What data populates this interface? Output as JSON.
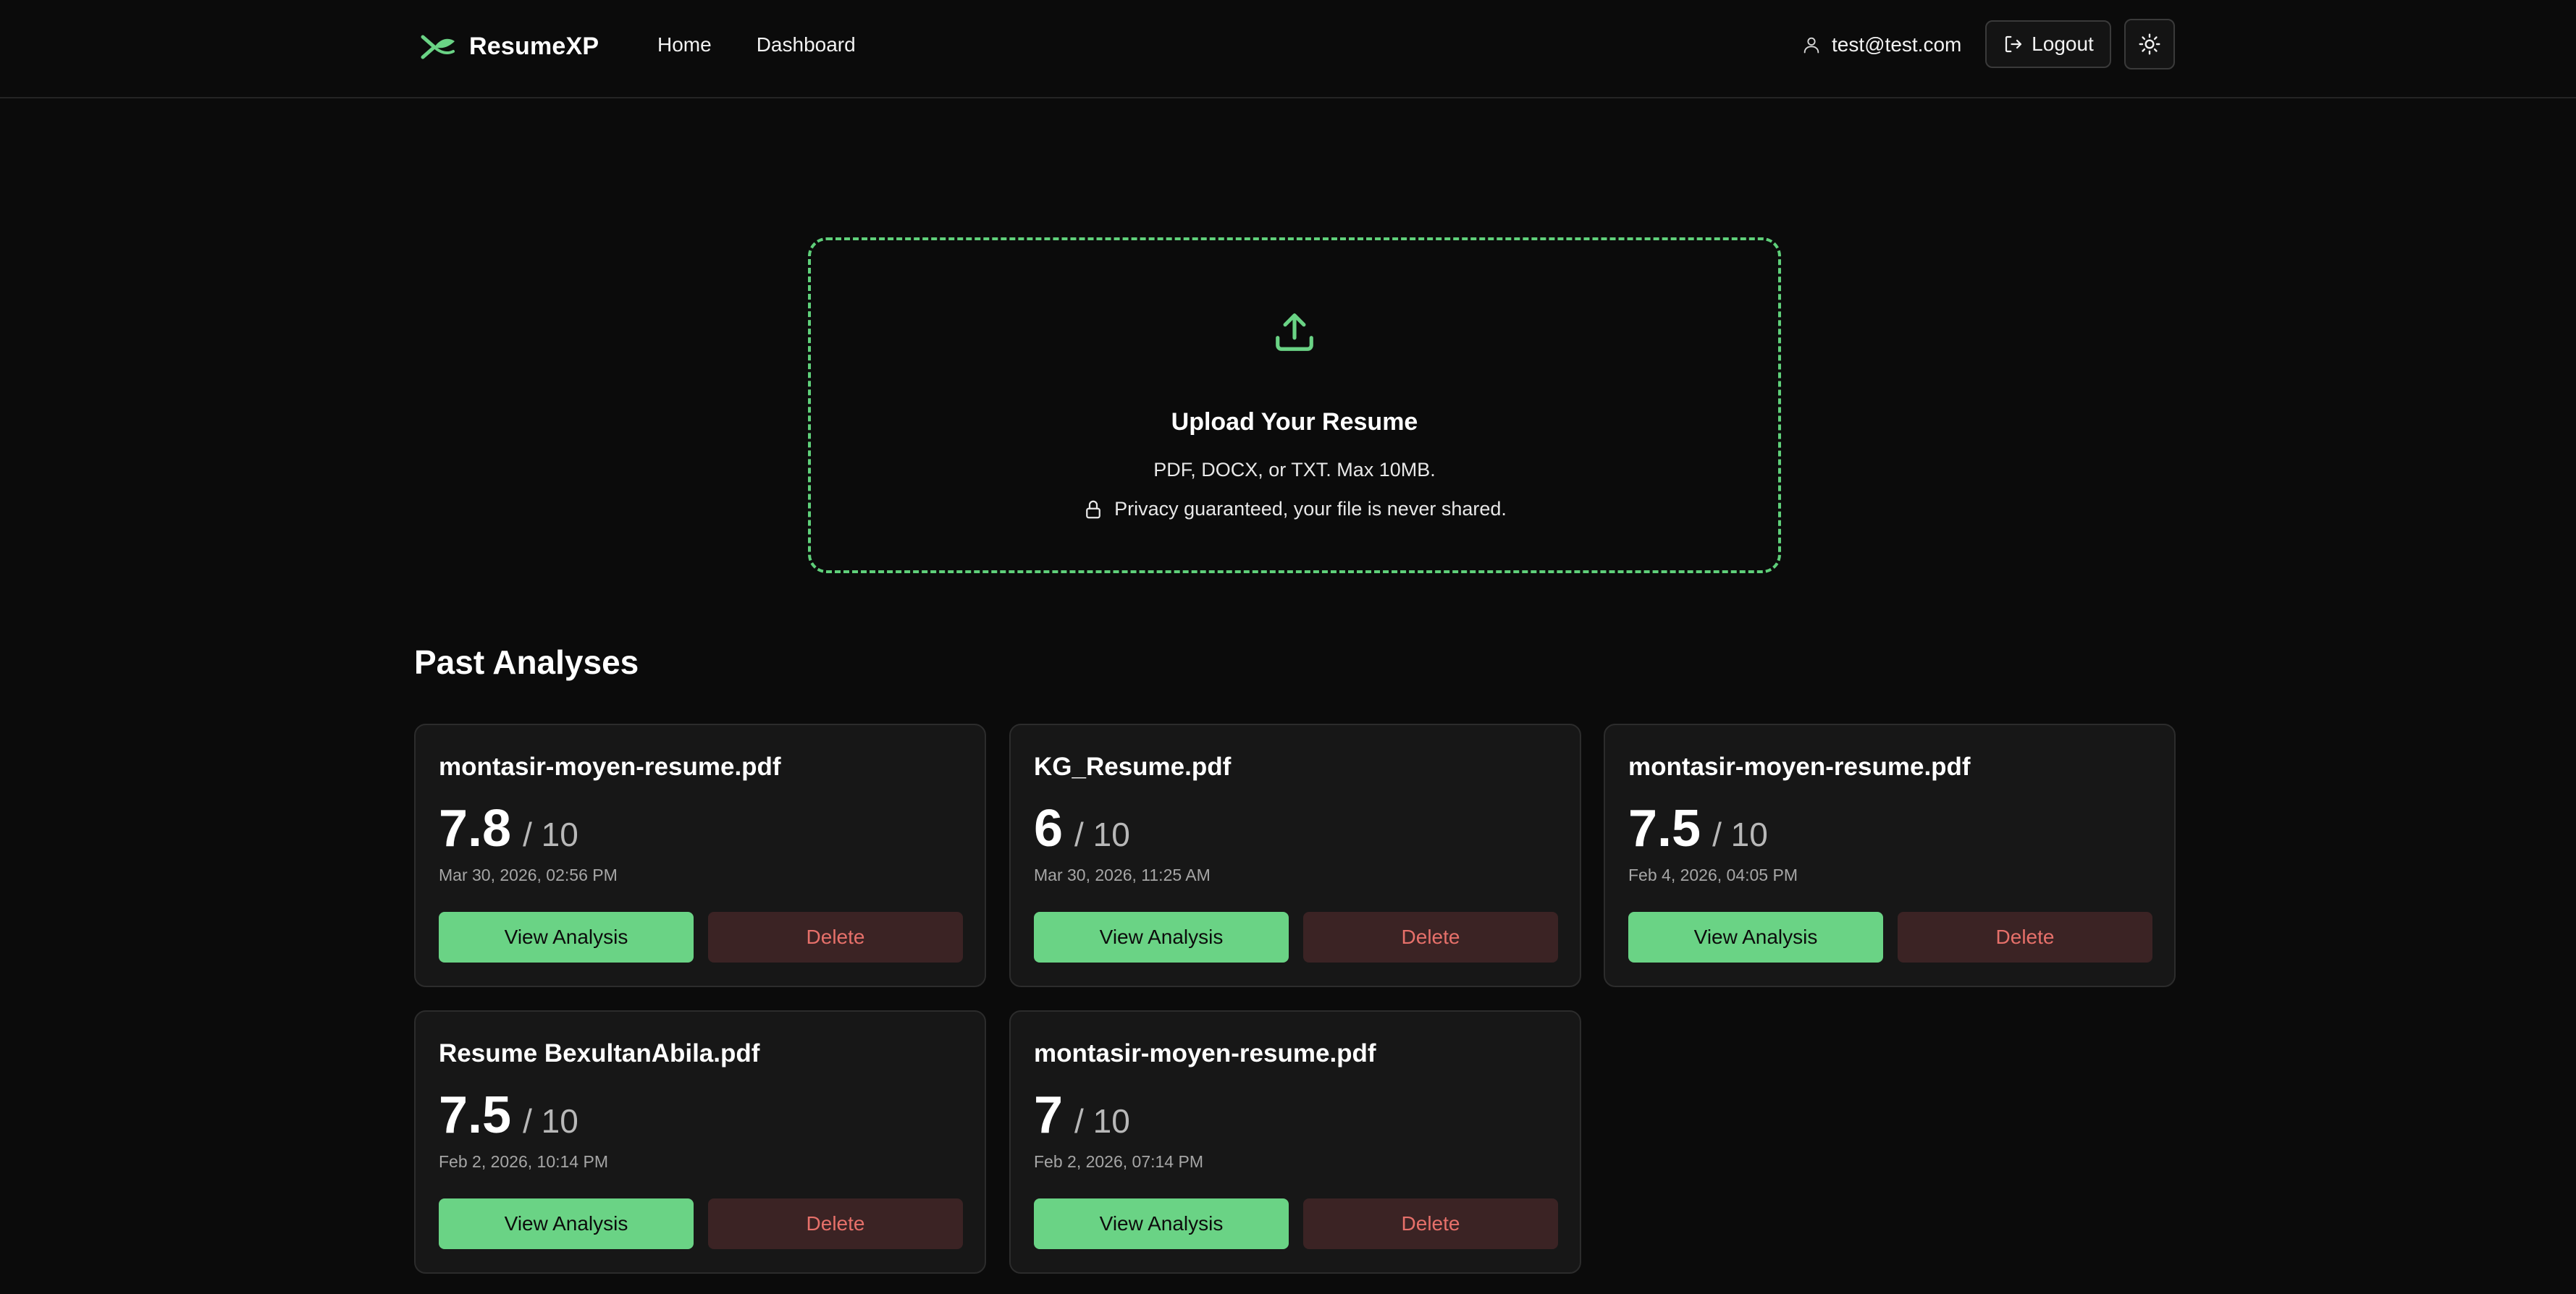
{
  "header": {
    "brand": "ResumeXP",
    "nav": [
      {
        "label": "Home"
      },
      {
        "label": "Dashboard"
      }
    ],
    "user_email": "test@test.com",
    "logout_label": "Logout",
    "theme_toggle_icon": "sun-icon"
  },
  "upload": {
    "icon": "upload-icon",
    "title": "Upload Your Resume",
    "formats": "PDF, DOCX, or TXT. Max 10MB.",
    "privacy_icon": "lock-icon",
    "privacy": "Privacy guaranteed, your file is never shared."
  },
  "past": {
    "title": "Past Analyses",
    "cards": [
      {
        "name": "montasir-moyen-resume.pdf",
        "score": "7.8",
        "max": "/ 10",
        "date": "Mar 30, 2026, 02:56 PM",
        "view_label": "View Analysis",
        "delete_label": "Delete"
      },
      {
        "name": "KG_Resume.pdf",
        "score": "6",
        "max": "/ 10",
        "date": "Mar 30, 2026, 11:25 AM",
        "view_label": "View Analysis",
        "delete_label": "Delete"
      },
      {
        "name": "montasir-moyen-resume.pdf",
        "score": "7.5",
        "max": "/ 10",
        "date": "Feb 4, 2026, 04:05 PM",
        "view_label": "View Analysis",
        "delete_label": "Delete"
      },
      {
        "name": "Resume BexultanAbila.pdf",
        "score": "7.5",
        "max": "/ 10",
        "date": "Feb 2, 2026, 10:14 PM",
        "view_label": "View Analysis",
        "delete_label": "Delete"
      },
      {
        "name": "montasir-moyen-resume.pdf",
        "score": "7",
        "max": "/ 10",
        "date": "Feb 2, 2026, 07:14 PM",
        "view_label": "View Analysis",
        "delete_label": "Delete"
      }
    ]
  },
  "colors": {
    "accent": "#6ad385",
    "background": "#0b0b0b",
    "card": "#171717",
    "delete_bg": "#3b2324",
    "delete_text": "#e6706a"
  }
}
